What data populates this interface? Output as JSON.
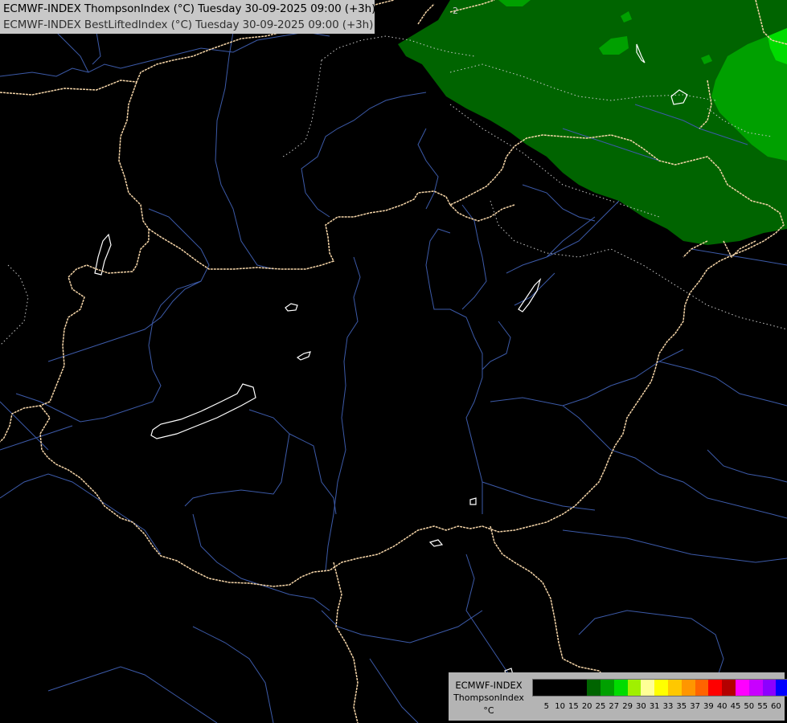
{
  "header": {
    "line1": "ECMWF-INDEX ThompsonIndex (°C) Tuesday 30-09-2025 09:00 (+3h)",
    "line2": "ECMWF-INDEX BestLiftedIndex (°C) Tuesday 30-09-2025 09:00 (+3h)"
  },
  "map": {
    "contour_label": "2",
    "colors": {
      "background": "#000000",
      "border": "#f5d5a8",
      "river": "#3c5aa8",
      "lake": "#ffffff",
      "dotted_contour": "#c8c8c8",
      "green_dark": "#006400",
      "green_mid": "#00a000",
      "green_bright": "#00dc00"
    }
  },
  "legend": {
    "model": "ECMWF-INDEX",
    "parameter": "ThompsonIndex",
    "unit": "°C",
    "colors": [
      "#000000",
      "#000000",
      "#000000",
      "#000000",
      "#006400",
      "#00a000",
      "#00dc00",
      "#a0f000",
      "#ffff96",
      "#ffff00",
      "#ffc800",
      "#ff9600",
      "#ff6400",
      "#ff0000",
      "#b40000",
      "#ff00ff",
      "#c800ff",
      "#8c00ff",
      "#0000ff"
    ],
    "ticks": [
      "5",
      "10",
      "15",
      "20",
      "25",
      "27",
      "29",
      "30",
      "31",
      "33",
      "35",
      "37",
      "39",
      "40",
      "45",
      "50",
      "55",
      "60"
    ]
  }
}
